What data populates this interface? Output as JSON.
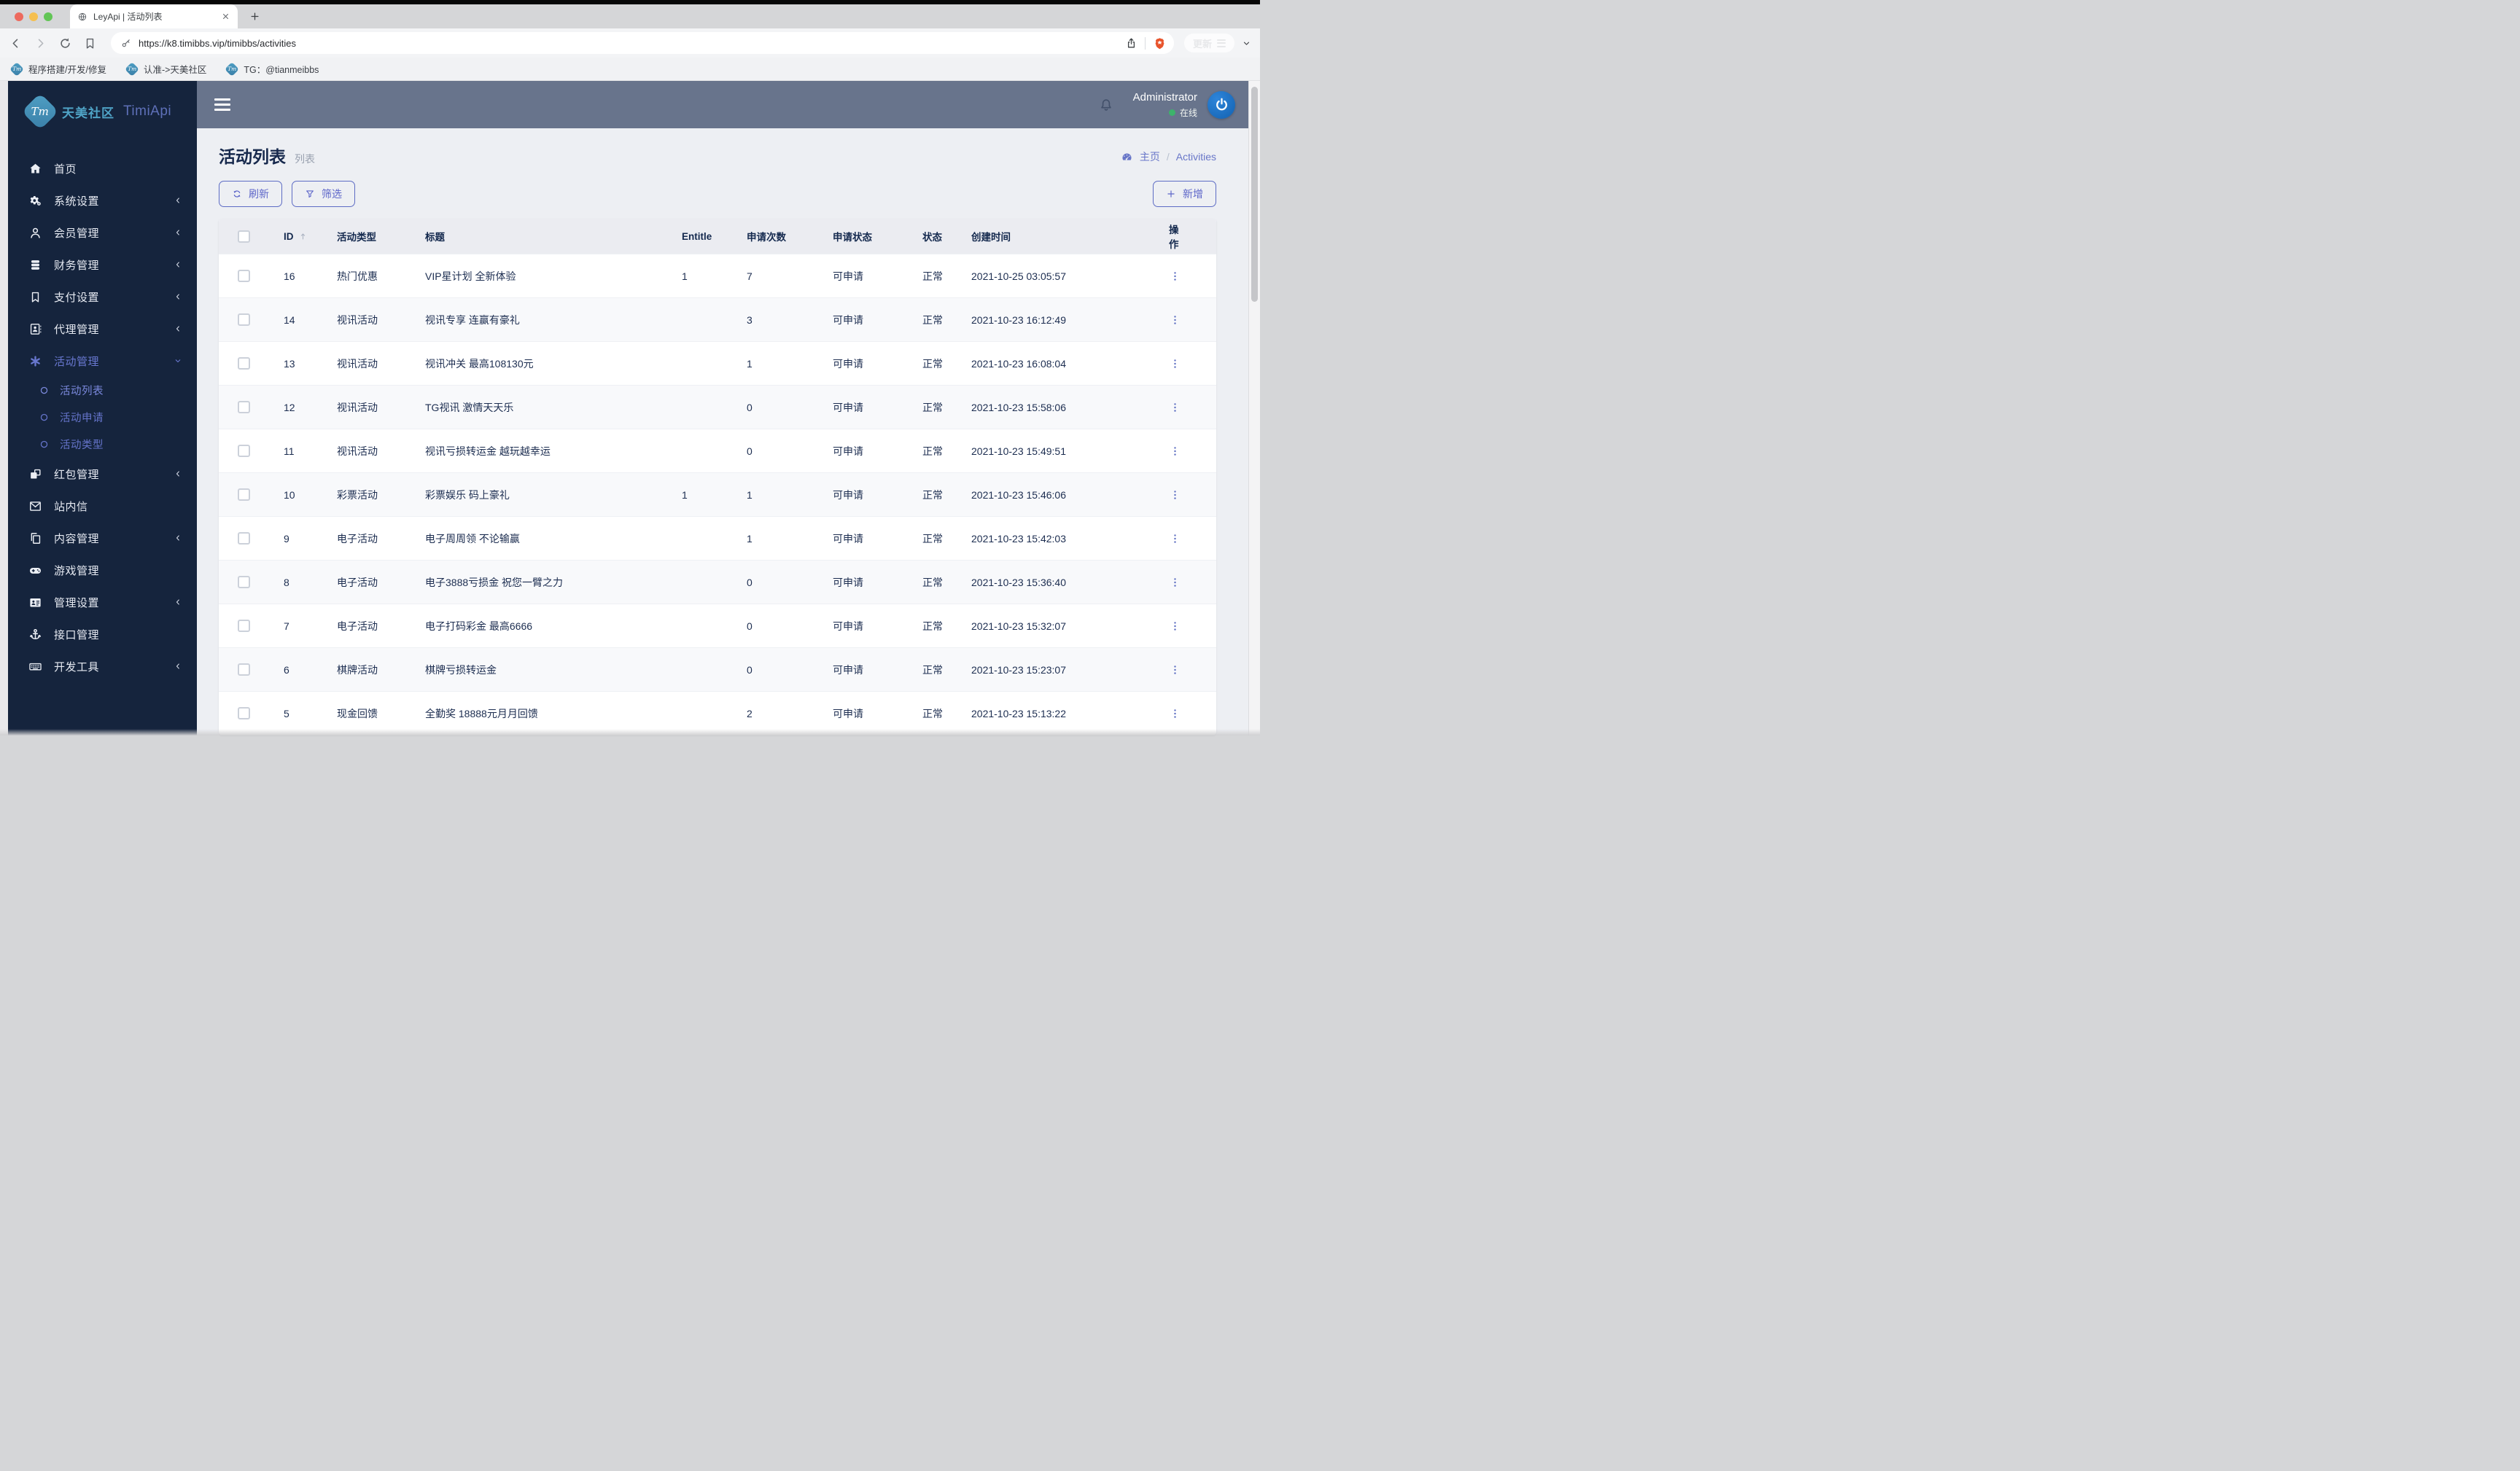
{
  "browser": {
    "tab": {
      "title": "LeyApi | 活动列表",
      "favicon": "globe-icon"
    },
    "url": "https://k8.timibbs.vip/timibbs/activities",
    "update_label": "更新",
    "bookmarks": [
      {
        "label": "程序搭建/开发/修复",
        "icon": "tm-favicon-icon"
      },
      {
        "label": "认准->天美社区",
        "icon": "tm-favicon-icon"
      },
      {
        "label": "TG：@tianmeibbs",
        "icon": "tm-favicon-icon"
      }
    ]
  },
  "app": {
    "brand": {
      "logo": "Tm",
      "community": "天美社区",
      "product": "TimiApi"
    },
    "user": {
      "name": "Administrator",
      "status": "在线"
    },
    "sidebar": {
      "items": [
        {
          "name": "home",
          "icon": "home-icon",
          "label": "首页"
        },
        {
          "name": "system-settings",
          "icon": "gears-icon",
          "label": "系统设置",
          "chevron": "left"
        },
        {
          "name": "member-management",
          "icon": "user-icon",
          "label": "会员管理",
          "chevron": "left"
        },
        {
          "name": "finance-management",
          "icon": "database-icon",
          "label": "财务管理",
          "chevron": "left"
        },
        {
          "name": "payment-settings",
          "icon": "bookmark-icon",
          "label": "支付设置",
          "chevron": "left"
        },
        {
          "name": "agent-management",
          "icon": "address-book-icon",
          "label": "代理管理",
          "chevron": "left"
        },
        {
          "name": "activity-management",
          "icon": "asterisk-icon",
          "label": "活动管理",
          "chevron": "down",
          "active": true,
          "children": [
            {
              "name": "activity-list",
              "icon": "circle-icon",
              "label": "活动列表",
              "active": true
            },
            {
              "name": "activity-apply",
              "icon": "circle-icon",
              "label": "活动申请"
            },
            {
              "name": "activity-type",
              "icon": "circle-icon",
              "label": "活动类型"
            }
          ]
        },
        {
          "name": "redpacket-management",
          "icon": "boxes-icon",
          "label": "红包管理",
          "chevron": "left"
        },
        {
          "name": "site-message",
          "icon": "envelope-icon",
          "label": "站内信"
        },
        {
          "name": "content-management",
          "icon": "copy-icon",
          "label": "内容管理",
          "chevron": "left"
        },
        {
          "name": "game-management",
          "icon": "gamepad-icon",
          "label": "游戏管理"
        },
        {
          "name": "admin-settings",
          "icon": "id-card-icon",
          "label": "管理设置",
          "chevron": "left"
        },
        {
          "name": "api-management",
          "icon": "anchor-icon",
          "label": "接口管理"
        },
        {
          "name": "dev-tools",
          "icon": "keyboard-icon",
          "label": "开发工具",
          "chevron": "left"
        }
      ]
    },
    "page": {
      "title": "活动列表",
      "subtitle": "列表",
      "breadcrumb": {
        "home": "主页",
        "separator": "/",
        "current": "Activities"
      }
    },
    "toolbar": {
      "refresh": "刷新",
      "filter": "筛选",
      "add": "新增"
    },
    "table": {
      "columns": [
        "ID",
        "活动类型",
        "标题",
        "Entitle",
        "申请次数",
        "申请状态",
        "状态",
        "创建时间",
        "操作"
      ],
      "rows": [
        {
          "id": "16",
          "type": "热门优惠",
          "title": "VIP星计划 全新体验",
          "entitle": "1",
          "count": "7",
          "apply_status": "可申请",
          "status": "正常",
          "created": "2021-10-25 03:05:57"
        },
        {
          "id": "14",
          "type": "视讯活动",
          "title": "视讯专享 连赢有豪礼",
          "entitle": "",
          "count": "3",
          "apply_status": "可申请",
          "status": "正常",
          "created": "2021-10-23 16:12:49"
        },
        {
          "id": "13",
          "type": "视讯活动",
          "title": "视讯冲关 最高108130元",
          "entitle": "",
          "count": "1",
          "apply_status": "可申请",
          "status": "正常",
          "created": "2021-10-23 16:08:04"
        },
        {
          "id": "12",
          "type": "视讯活动",
          "title": "TG视讯 激情天天乐",
          "entitle": "",
          "count": "0",
          "apply_status": "可申请",
          "status": "正常",
          "created": "2021-10-23 15:58:06"
        },
        {
          "id": "11",
          "type": "视讯活动",
          "title": "视讯亏损转运金 越玩越幸运",
          "entitle": "",
          "count": "0",
          "apply_status": "可申请",
          "status": "正常",
          "created": "2021-10-23 15:49:51"
        },
        {
          "id": "10",
          "type": "彩票活动",
          "title": "彩票娱乐 码上豪礼",
          "entitle": "1",
          "count": "1",
          "apply_status": "可申请",
          "status": "正常",
          "created": "2021-10-23 15:46:06"
        },
        {
          "id": "9",
          "type": "电子活动",
          "title": "电子周周领 不论输赢",
          "entitle": "",
          "count": "1",
          "apply_status": "可申请",
          "status": "正常",
          "created": "2021-10-23 15:42:03"
        },
        {
          "id": "8",
          "type": "电子活动",
          "title": "电子3888亏损金 祝您一臂之力",
          "entitle": "",
          "count": "0",
          "apply_status": "可申请",
          "status": "正常",
          "created": "2021-10-23 15:36:40"
        },
        {
          "id": "7",
          "type": "电子活动",
          "title": "电子打码彩金 最高6666",
          "entitle": "",
          "count": "0",
          "apply_status": "可申请",
          "status": "正常",
          "created": "2021-10-23 15:32:07"
        },
        {
          "id": "6",
          "type": "棋牌活动",
          "title": "棋牌亏损转运金",
          "entitle": "",
          "count": "0",
          "apply_status": "可申请",
          "status": "正常",
          "created": "2021-10-23 15:23:07"
        },
        {
          "id": "5",
          "type": "现金回馈",
          "title": "全勤奖 18888元月月回馈",
          "entitle": "",
          "count": "2",
          "apply_status": "可申请",
          "status": "正常",
          "created": "2021-10-23 15:13:22"
        }
      ]
    },
    "colors": {
      "sidebar_bg": "#15243d",
      "sidebar_active": "#6877cf",
      "topbar_bg": "#68748c",
      "accent": "#5d6cc4",
      "content_bg": "#edeff3",
      "online_green": "#3db36b",
      "brand_teal": "#4fa3c6",
      "brand_purple": "#5e70b8",
      "brave_orange": "#e8542c",
      "row_text": "#1c2d50"
    }
  }
}
